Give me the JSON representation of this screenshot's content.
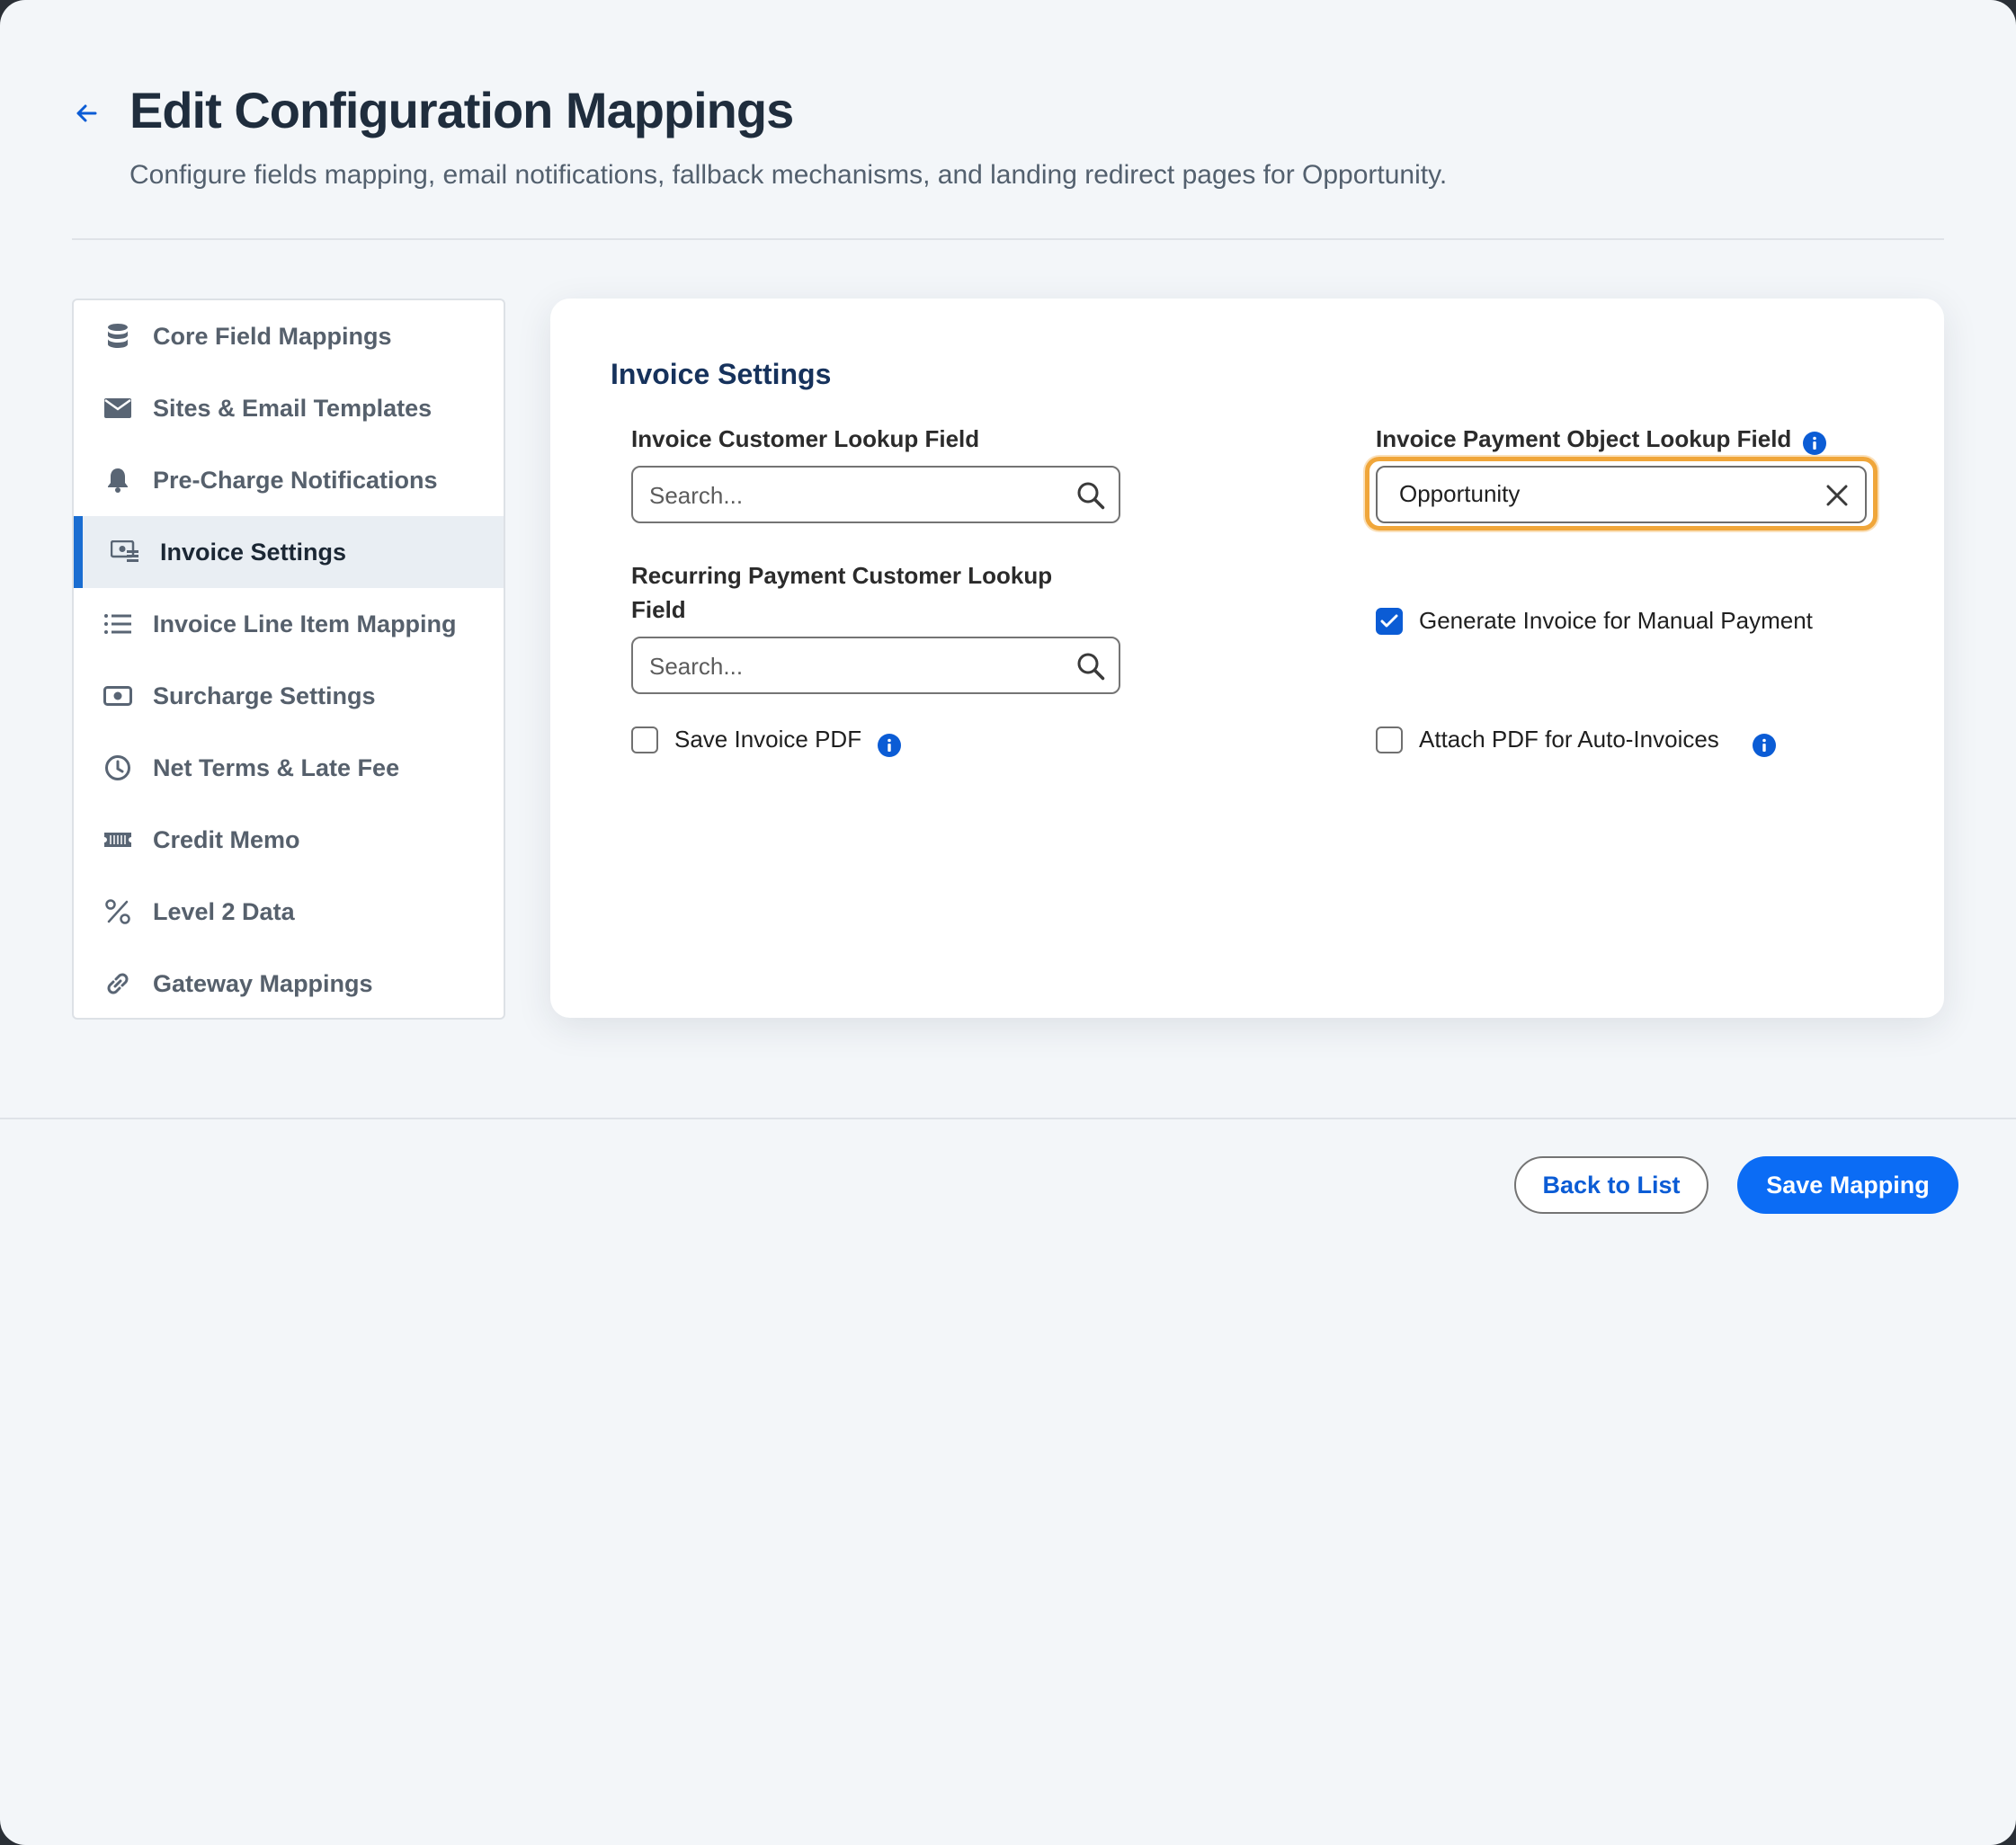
{
  "header": {
    "title": "Edit Configuration Mappings",
    "subtitle": "Configure fields mapping, email notifications, fallback mechanisms, and landing redirect pages for Opportunity."
  },
  "sidebar": {
    "items": [
      {
        "label": "Core Field Mappings",
        "icon": "database-icon",
        "active": false
      },
      {
        "label": "Sites & Email Templates",
        "icon": "envelope-icon",
        "active": false
      },
      {
        "label": "Pre-Charge Notifications",
        "icon": "bell-icon",
        "active": false
      },
      {
        "label": "Invoice Settings",
        "icon": "invoice-icon",
        "active": true
      },
      {
        "label": "Invoice Line Item Mapping",
        "icon": "list-icon",
        "active": false
      },
      {
        "label": "Surcharge Settings",
        "icon": "money-icon",
        "active": false
      },
      {
        "label": "Net Terms & Late Fee",
        "icon": "clock-icon",
        "active": false
      },
      {
        "label": "Credit Memo",
        "icon": "ticket-icon",
        "active": false
      },
      {
        "label": "Level 2 Data",
        "icon": "percent-icon",
        "active": false
      },
      {
        "label": "Gateway Mappings",
        "icon": "link-icon",
        "active": false
      }
    ]
  },
  "main": {
    "section_title": "Invoice Settings",
    "invoice_customer_lookup": {
      "label": "Invoice Customer Lookup Field",
      "placeholder": "Search..."
    },
    "recurring_customer_lookup": {
      "label": "Recurring Payment Customer Lookup Field",
      "placeholder": "Search..."
    },
    "invoice_payment_object_lookup": {
      "label": "Invoice Payment Object Lookup Field",
      "value": "Opportunity"
    },
    "generate_invoice_manual": {
      "label": "Generate Invoice for Manual Payment",
      "checked": true
    },
    "save_invoice_pdf": {
      "label": "Save Invoice PDF",
      "checked": false
    },
    "attach_pdf_auto": {
      "label": "Attach PDF for Auto-Invoices",
      "checked": false
    }
  },
  "footer": {
    "back_label": "Back to List",
    "save_label": "Save Mapping"
  },
  "colors": {
    "accent": "#0b6cf5",
    "active_nav_bar": "#1a6dd1",
    "focus_ring": "#f0a63a",
    "info": "#0b5cd5"
  }
}
